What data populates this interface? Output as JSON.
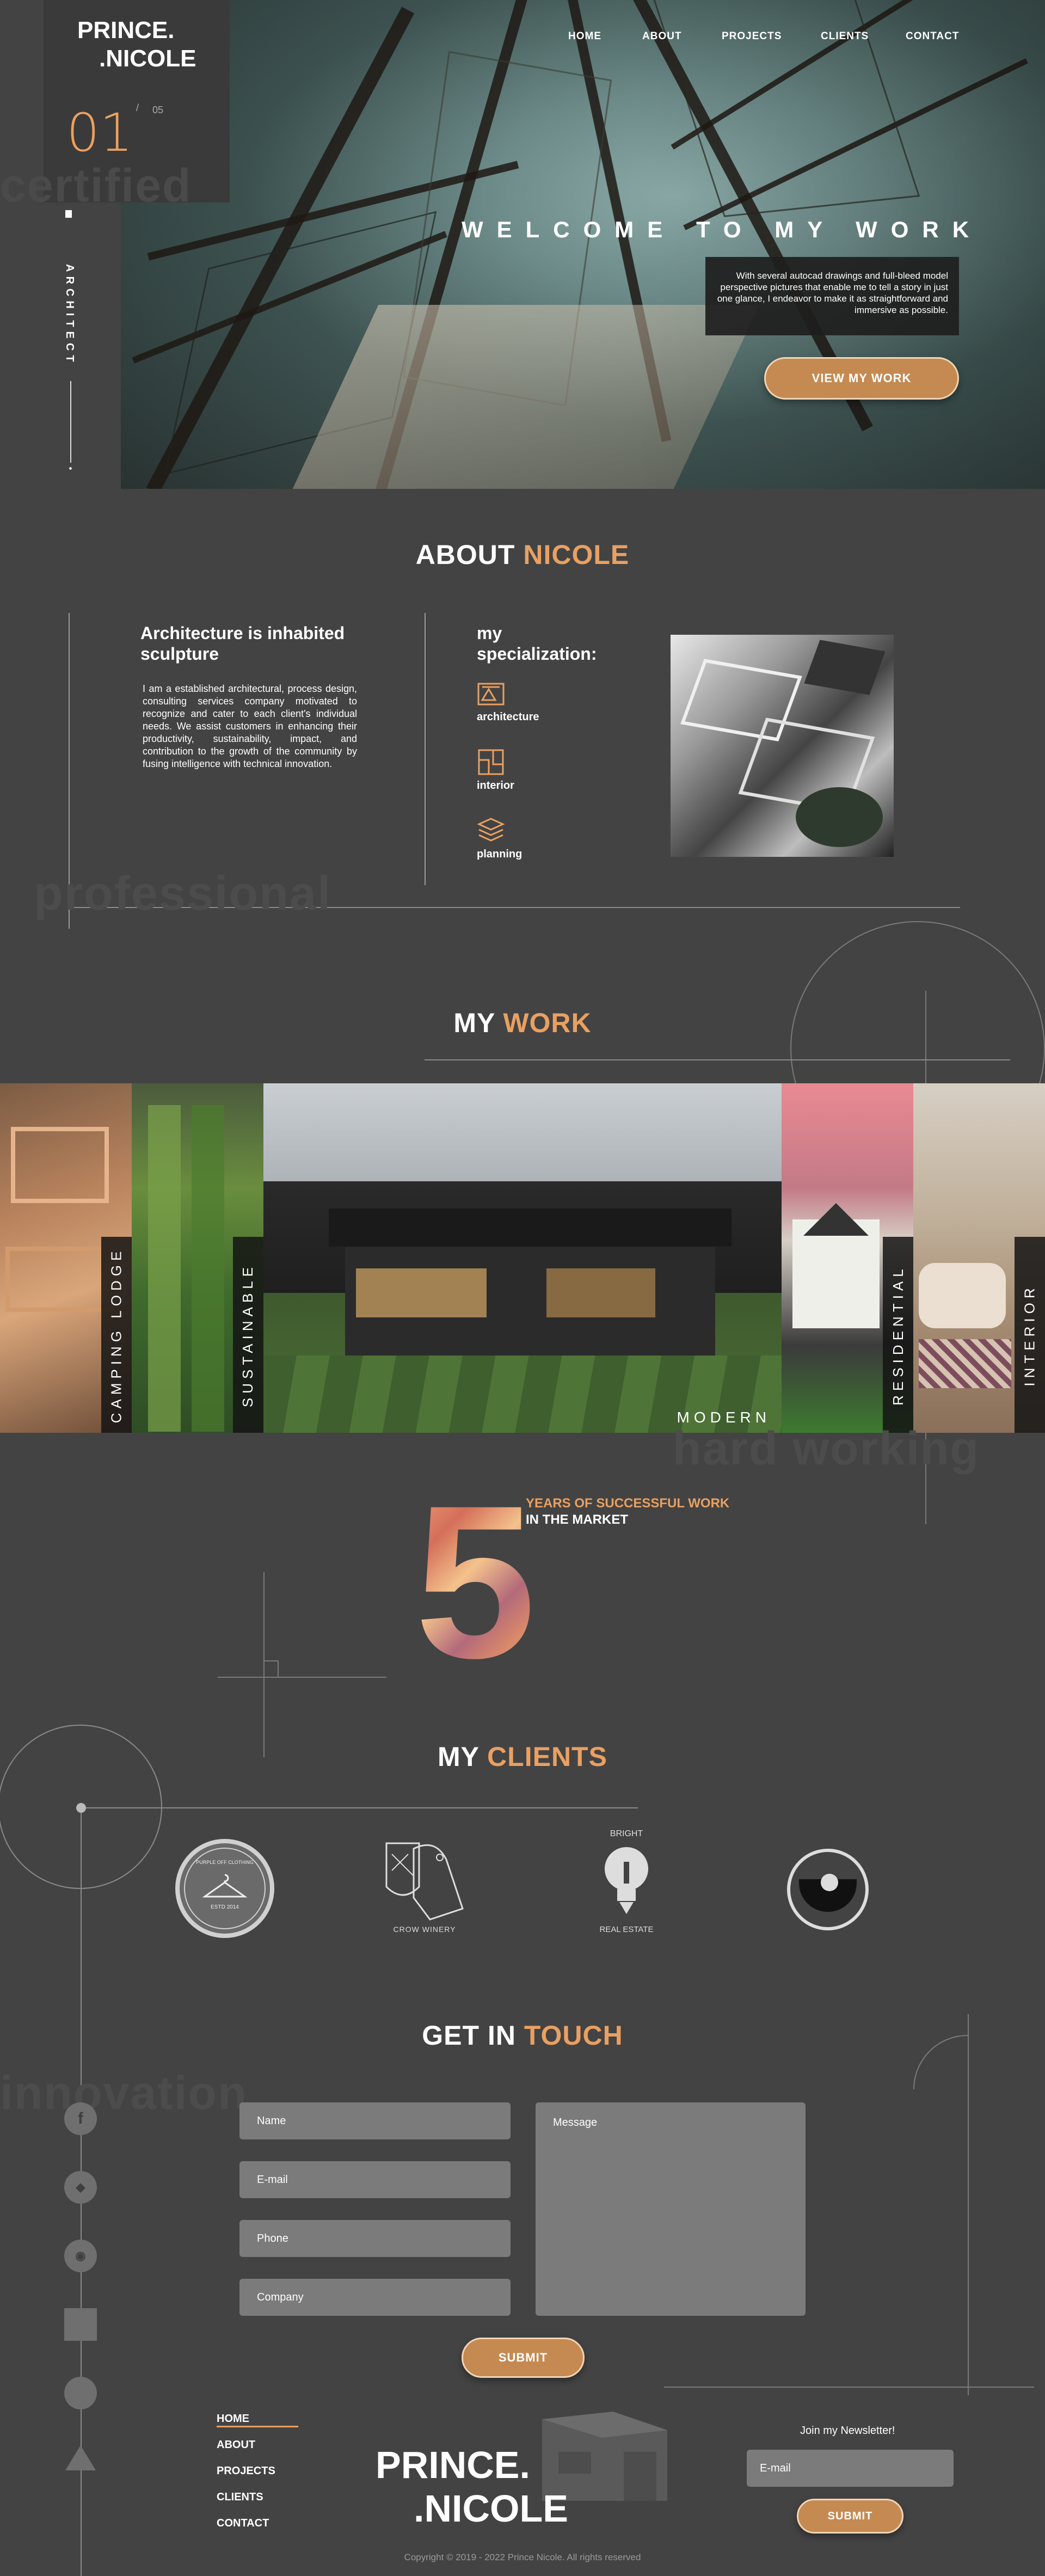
{
  "brand": {
    "line1": "PRINCE.",
    "line2": ".NICOLE"
  },
  "slide": {
    "current": "01",
    "separator": "/",
    "total": "05"
  },
  "side_tag": "ARCHITECT",
  "nav": [
    "HOME",
    "ABOUT",
    "PROJECTS",
    "CLIENTS",
    "CONTACT"
  ],
  "hero": {
    "title": "WELCOME TO MY WORK",
    "text": "With several autocad drawings and full-bleed model perspective pictures that enable me to tell a story in just one glance, I endeavor to make it as straightforward and immersive as possible.",
    "button": "VIEW MY WORK"
  },
  "bg_words": {
    "certified": "certified",
    "professional": "professional",
    "hard_working": "hard working",
    "innovation": "innovation"
  },
  "about": {
    "title_white": "ABOUT",
    "title_accent": "NICOLE",
    "heading": "Architecture is inhabited sculpture",
    "body": "I am a established architectural, process design, consulting services company motivated to recognize and cater to each client's individual needs. We assist customers in enhancing their productivity, sustainability, impact, and contribution to the growth of the community by fusing intelligence with technical innovation.",
    "spec_title": "my specialization:",
    "specs": [
      {
        "label": "architecture",
        "icon": "drafting-icon"
      },
      {
        "label": "interior",
        "icon": "floorplan-icon"
      },
      {
        "label": "planning",
        "icon": "layers-icon"
      }
    ]
  },
  "work": {
    "title_white": "MY",
    "title_accent": "WORK",
    "panels": [
      "CAMPING LODGE",
      "SUSTAINABLE",
      "MODERN",
      "RESIDENTIAL",
      "INTERIOR"
    ]
  },
  "stats": {
    "number": "5",
    "line1": "YEARS OF SUCCESSFUL WORK",
    "line2": "IN THE MARKET"
  },
  "clients": {
    "title_white": "MY",
    "title_accent": "CLIENTS",
    "logo1": "PURPLE OFF CLOTHING",
    "logo1_year": "ESTD 2014",
    "logo2": "CROW WINERY",
    "logo3_top": "BRIGHT",
    "logo3_bottom": "REAL ESTATE"
  },
  "contact": {
    "title_white": "GET IN",
    "title_accent": "TOUCH",
    "fields": [
      "Name",
      "E-mail",
      "Phone",
      "Company"
    ],
    "message": "Message",
    "submit": "SUBMIT"
  },
  "footer": {
    "links": [
      "HOME",
      "ABOUT",
      "PROJECTS",
      "CLIENTS",
      "CONTACT"
    ],
    "newsletter": "Join my Newsletter!",
    "email": "E-mail",
    "submit": "SUBMIT",
    "copyright": "Copyright  ©  2019 - 2022 Prince Nicole. All rights reserved"
  },
  "colors": {
    "accent": "#e9a062",
    "background": "#434343",
    "button": "#c58a52",
    "field": "#7b7b7b"
  }
}
